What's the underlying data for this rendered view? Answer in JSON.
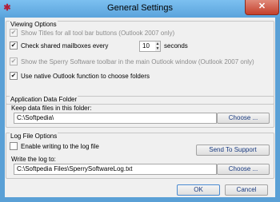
{
  "window": {
    "title": "General Settings",
    "close_glyph": "✕",
    "app_icon": "app-icon"
  },
  "viewing": {
    "title": "Viewing Options",
    "show_titles_label": "Show Titles for all tool bar buttons (Outlook 2007 only)",
    "show_titles_checked": true,
    "check_mailboxes_label": "Check shared mailboxes every",
    "check_mailboxes_checked": true,
    "interval_value": "10",
    "interval_unit": "seconds",
    "show_toolbar_label": "Show the Sperry Software toolbar in the main Outlook window (Outlook 2007 only)",
    "show_toolbar_checked": true,
    "native_outlook_label": "Use native Outlook function to choose folders",
    "native_outlook_checked": true
  },
  "appdata": {
    "title": "Application Data Folder",
    "keep_label": "Keep data files in this folder:",
    "folder_value": "C:\\Softpedia\\",
    "choose_label": "Choose ..."
  },
  "log": {
    "title": "Log File Options",
    "enable_label": "Enable writing to the log file",
    "enable_checked": false,
    "send_support_label": "Send To Support",
    "write_to_label": "Write the log to:",
    "log_path_value": "C:\\Softpedia Files\\SperrySoftwareLog.txt",
    "choose_label": "Choose ..."
  },
  "footer": {
    "ok_label": "OK",
    "cancel_label": "Cancel"
  }
}
